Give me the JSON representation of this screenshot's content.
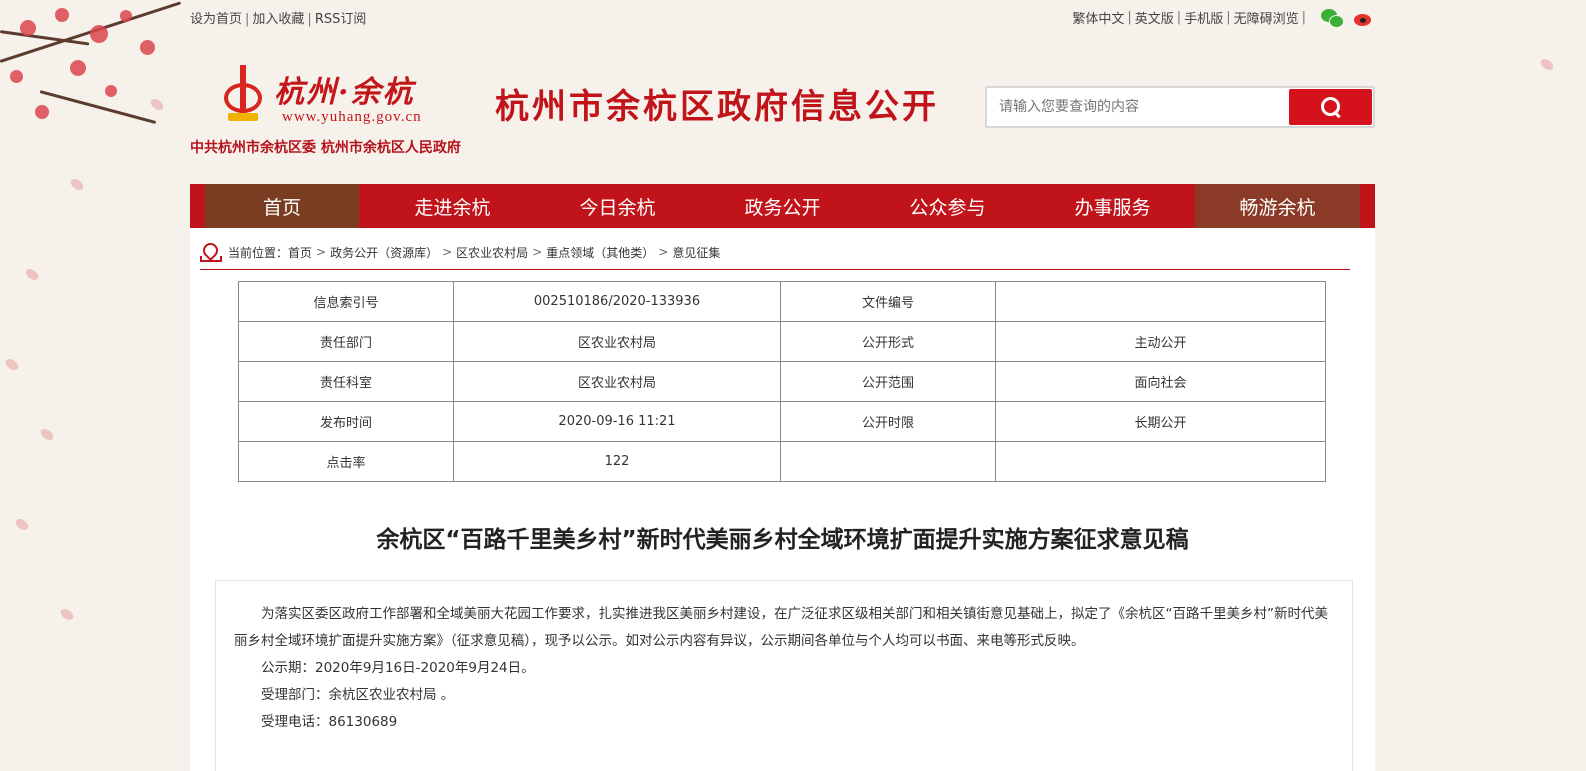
{
  "topbar": {
    "left_links": [
      "设为首页",
      "加入收藏",
      "RSS订阅"
    ],
    "right_links": [
      "繁体中文",
      "英文版",
      "手机版",
      "无障碍浏览"
    ]
  },
  "header": {
    "logo_text": "杭州·余杭",
    "logo_url": "www.yuhang.gov.cn",
    "org_line": "中共杭州市余杭区委  杭州市余杭区人民政府",
    "site_title": "杭州市余杭区政府信息公开",
    "search_placeholder": "请输入您要查询的内容"
  },
  "nav": {
    "items": [
      "首页",
      "走进余杭",
      "今日余杭",
      "政务公开",
      "公众参与",
      "办事服务",
      "畅游余杭"
    ]
  },
  "breadcrumb": {
    "prefix": "当前位置：",
    "items": [
      "首页",
      "政务公开（资源库）",
      "区农业农村局",
      "重点领域（其他类）",
      "意见征集"
    ]
  },
  "meta_table": {
    "rows": [
      [
        "信息索引号",
        "002510186/2020-133936",
        "文件编号",
        ""
      ],
      [
        "责任部门",
        "区农业农村局",
        "公开形式",
        "主动公开"
      ],
      [
        "责任科室",
        "区农业农村局",
        "公开范围",
        "面向社会"
      ],
      [
        "发布时间",
        "2020-09-16 11:21",
        "公开时限",
        "长期公开"
      ],
      [
        "点击率",
        "122",
        "",
        ""
      ]
    ]
  },
  "document": {
    "title": "余杭区“百路千里美乡村”新时代美丽乡村全域环境扩面提升实施方案征求意见稿",
    "paragraph": "为落实区委区政府工作部署和全域美丽大花园工作要求，扎实推进我区美丽乡村建设，在广泛征求区级相关部门和相关镇街意见基础上，拟定了《余杭区“百路千里美乡村”新时代美丽乡村全域环境扩面提升实施方案》（征求意见稿），现予以公示。如对公示内容有异议，公示期间各单位与个人均可以书面、来电等形式反映。",
    "period": "公示期：2020年9月16日-2020年9月24日。",
    "department": "受理部门：余杭区农业农村局 。",
    "phone": "受理电话：86130689"
  },
  "colors": {
    "brand_red": "#c0131a",
    "nav_active": "#7a3d22"
  },
  "icons": [
    "wechat-icon",
    "weibo-icon",
    "search-icon",
    "location-icon"
  ]
}
